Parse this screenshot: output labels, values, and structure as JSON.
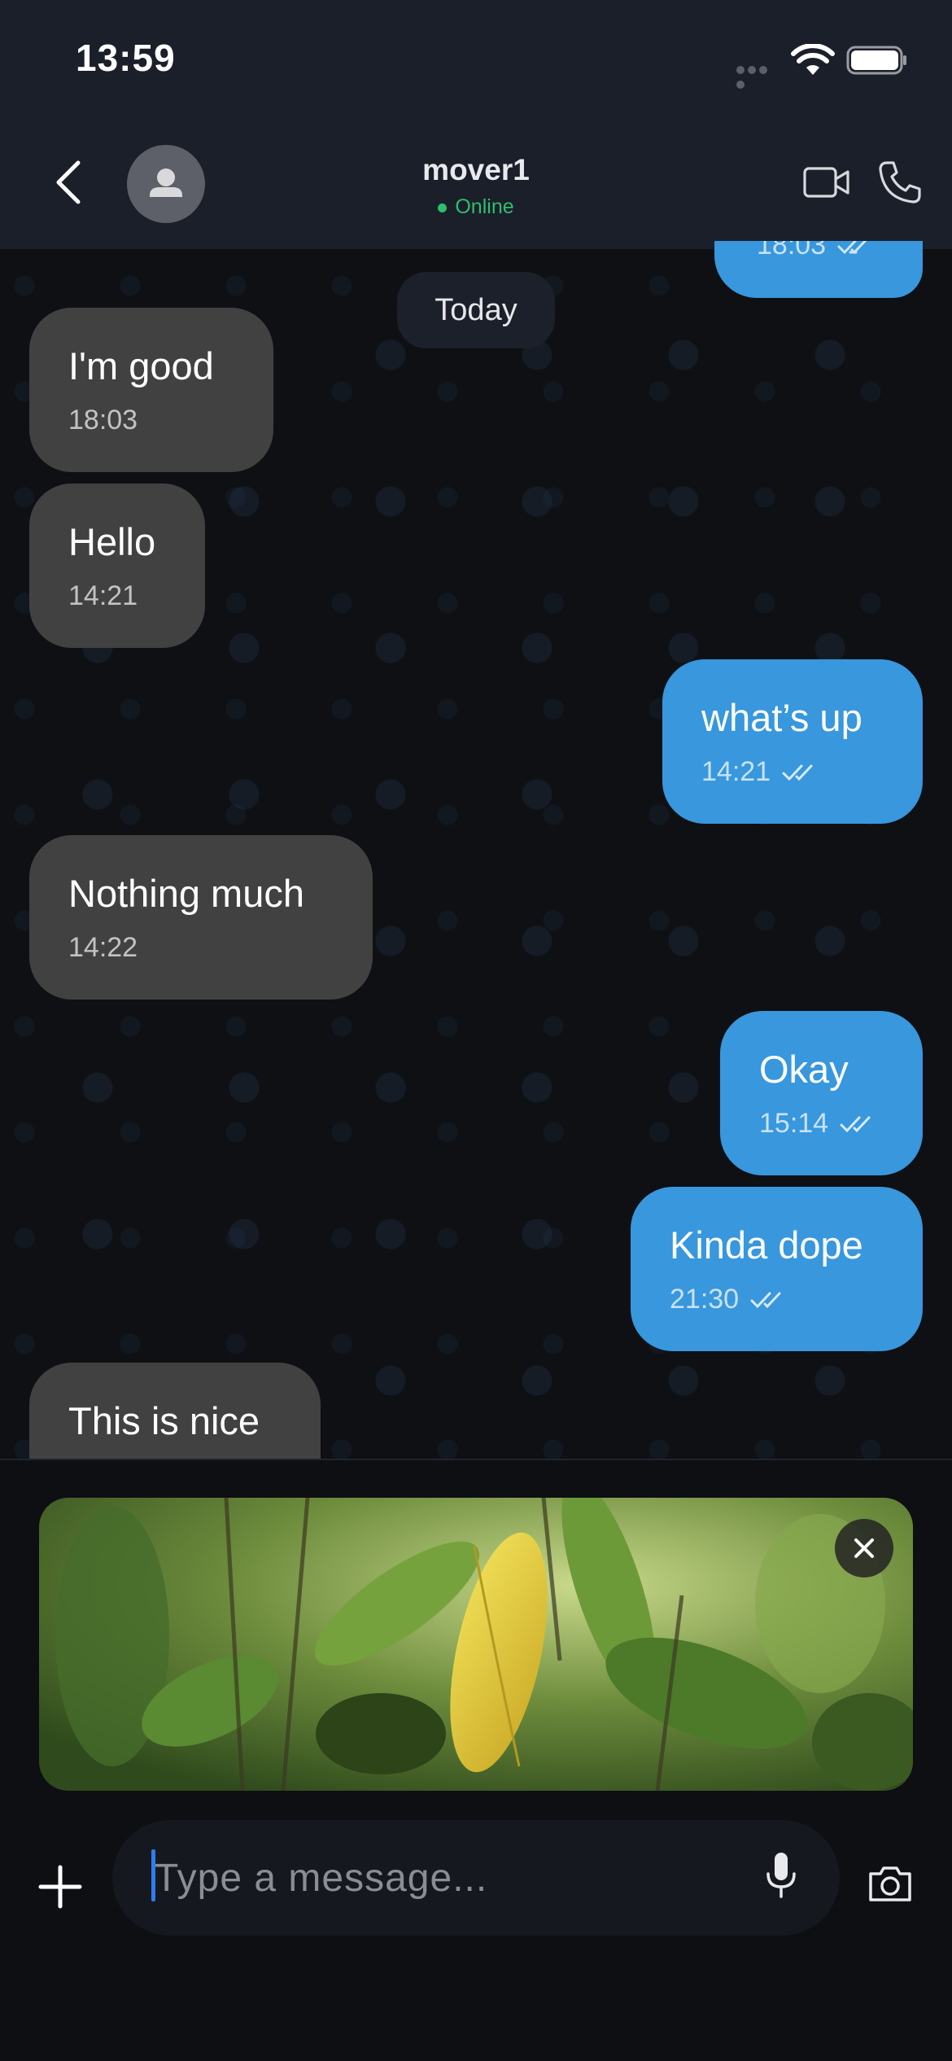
{
  "status_bar": {
    "time": "13:59"
  },
  "header": {
    "contact_name": "mover1",
    "presence": "Online",
    "colors": {
      "online": "#2fbf6a"
    }
  },
  "chat": {
    "date_separator": "Today",
    "partial_top_time": "18:03",
    "messages": [
      {
        "direction": "incoming",
        "text": "I'm good",
        "time": "18:03"
      },
      {
        "direction": "incoming",
        "text": "Hello",
        "time": "14:21"
      },
      {
        "direction": "outgoing",
        "text": "what’s up",
        "time": "14:21",
        "read": true
      },
      {
        "direction": "incoming",
        "text": "Nothing much",
        "time": "14:22"
      },
      {
        "direction": "outgoing",
        "text": "Okay",
        "time": "15:14",
        "read": true
      },
      {
        "direction": "outgoing",
        "text": "Kinda dope",
        "time": "21:30",
        "read": true
      },
      {
        "direction": "incoming",
        "text": "This is nice"
      }
    ],
    "colors": {
      "incoming_bubble": "#414141",
      "outgoing_bubble": "#3897dd"
    }
  },
  "composer": {
    "attachment": {
      "type": "photo",
      "subject": "yellow leaf among green foliage"
    },
    "placeholder": "Type a message...",
    "icons": [
      "plus-icon",
      "mic-icon",
      "camera-icon",
      "close-icon"
    ]
  }
}
